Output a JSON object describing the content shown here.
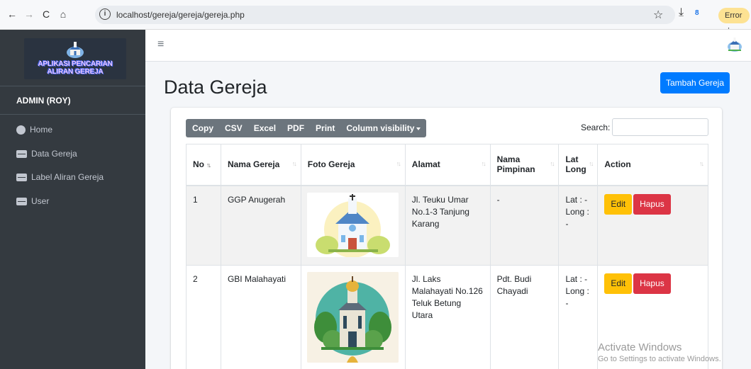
{
  "browser": {
    "url": "localhost/gereja/gereja/gereja.php",
    "error_label": "Error"
  },
  "sidebar": {
    "brand_line1": "APLIKASI PENCARIAN",
    "brand_line2": "ALIRAN GEREJA",
    "user": "ADMIN (ROY)",
    "items": [
      {
        "label": "Home",
        "icon": "tachometer-icon"
      },
      {
        "label": "Data Gereja",
        "icon": "table-icon"
      },
      {
        "label": "Label Aliran Gereja",
        "icon": "table-icon"
      },
      {
        "label": "User",
        "icon": "table-icon"
      }
    ]
  },
  "main": {
    "title": "Data Gereja",
    "add_button": "Tambah Gereja",
    "toolbar": [
      "Copy",
      "CSV",
      "Excel",
      "PDF",
      "Print",
      "Column visibility"
    ],
    "search_label": "Search:",
    "search_value": "",
    "columns": [
      "No",
      "Nama Gereja",
      "Foto Gereja",
      "Alamat",
      "Nama Pimpinan",
      "Lat Long",
      "Action"
    ],
    "columns_split": {
      "pimpinan_1": "Nama",
      "pimpinan_2": "Pimpinan",
      "latlong_1": "Lat",
      "latlong_2": "Long"
    },
    "rows": [
      {
        "no": "1",
        "nama": "GGP Anugerah",
        "alamat": "Jl. Teuku Umar No.1-3 Tanjung Karang",
        "pimpinan": "-",
        "lat": "Lat : -",
        "long": "Long : -"
      },
      {
        "no": "2",
        "nama": "GBI Malahayati",
        "alamat": "Jl. Laks Malahayati No.126 Teluk Betung Utara",
        "pimpinan": "Pdt. Budi Chayadi",
        "lat": "Lat : -",
        "long": "Long : -"
      }
    ],
    "edit_label": "Edit",
    "delete_label": "Hapus"
  },
  "watermark": {
    "line1": "Activate Windows",
    "line2": "Go to Settings to activate Windows."
  },
  "colors": {
    "primary": "#007bff",
    "warning": "#ffc107",
    "danger": "#dc3545",
    "sidebar": "#343a40"
  }
}
